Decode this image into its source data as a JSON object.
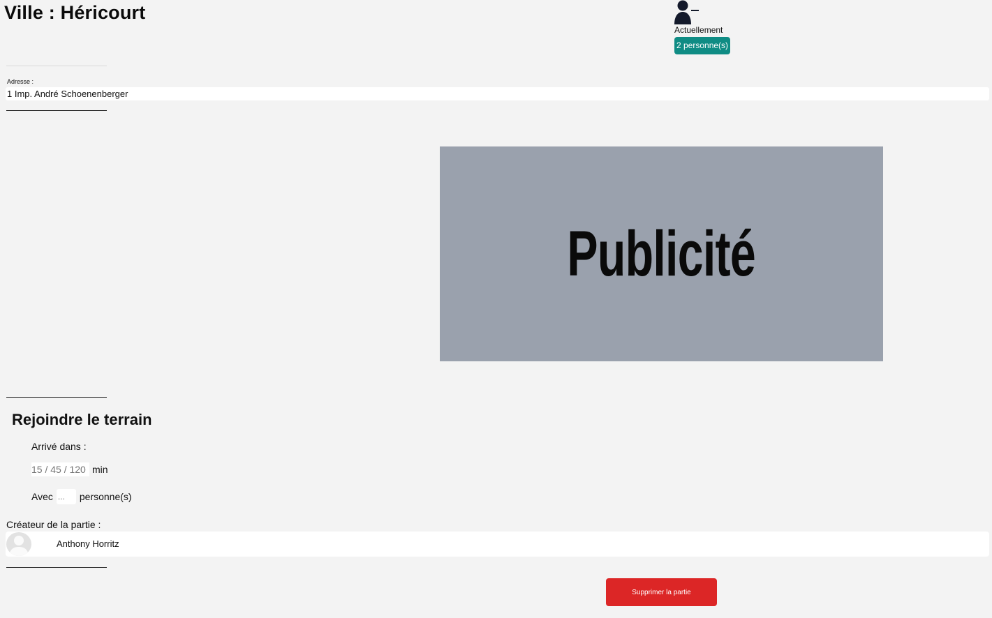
{
  "header": {
    "title": "Ville : Héricourt"
  },
  "occupancy": {
    "icon": "user-minus-icon",
    "label": "Actuellement",
    "count_badge": "2 personne(s)",
    "badge_color": "#0f8c84"
  },
  "address": {
    "label": "Adresse :",
    "value": "1 Imp. André Schoenenberger"
  },
  "advert": {
    "text": "Publicité",
    "background": "#9aa1ad"
  },
  "join": {
    "title": "Rejoindre le terrain",
    "arrive_label": "Arrivé dans :",
    "time_placeholder": "15 / 45 / 120",
    "time_unit": "min",
    "with_label": "Avec",
    "count_placeholder": "...",
    "count_unit": "personne(s)"
  },
  "creator": {
    "label": "Créateur de la partie :",
    "name": "Anthony Horritz",
    "avatar_icon": "default-avatar-icon"
  },
  "actions": {
    "delete_label": "Supprimer la partie",
    "delete_color": "#dc2626"
  }
}
